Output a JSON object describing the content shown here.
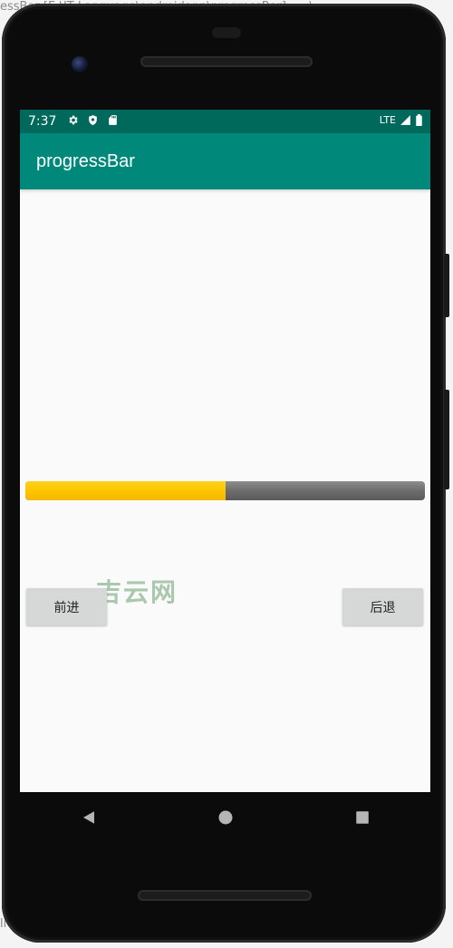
{
  "background": {
    "top_text": "essBar [E:\\IT Language\\androidapp\\progressBar] - ...\\",
    "bottom_text": "li"
  },
  "status_bar": {
    "time": "7:37",
    "left_icons": [
      "gear-icon",
      "shield-icon",
      "sd-card-icon"
    ],
    "network": "LTE",
    "right_icons": [
      "signal-icon",
      "battery-icon"
    ],
    "color": "#00695c"
  },
  "app_bar": {
    "title": "progressBar",
    "color": "#00897b"
  },
  "progress": {
    "value_percent": 50,
    "fill_color": "#ffc400",
    "track_color": "#6c6c6c"
  },
  "buttons": {
    "forward_label": "前进",
    "back_label": "后退"
  },
  "watermark": "吉云网",
  "nav": {
    "back_icon": "back-triangle-icon",
    "home_icon": "home-circle-icon",
    "recents_icon": "recents-square-icon"
  }
}
